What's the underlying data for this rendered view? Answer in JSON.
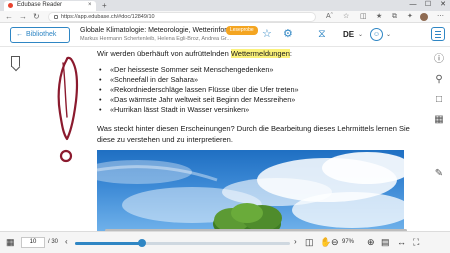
{
  "browser": {
    "tab_title": "Edubase Reader",
    "tab_close": "×",
    "new_tab": "+",
    "url": "https://app.edubase.ch/#doc/12849/10",
    "win_min": "—",
    "win_max": "☐",
    "win_close": "✕"
  },
  "header": {
    "back_label": "Bibliothek",
    "title": "Globale Klimatologie: Meteorologie, Wetterinform...",
    "authors": "Markus Hermann Schertenleib, Helena Egli-Broz, Andrea Gr...",
    "badge": "Leseprobe",
    "language": "DE"
  },
  "content": {
    "intro_prefix": "Wir werden überhäuft von aufrüttelnden ",
    "intro_highlight": "Wettermeldungen",
    "intro_suffix": ":",
    "bullets": [
      "«Der heisseste Sommer seit Menschengedenken»",
      "«Schneefall in der Sahara»",
      "«Rekordniederschläge lassen Flüsse über die Ufer treten»",
      "«Das wärmste Jahr weltweit seit Beginn der Messreihen»",
      "«Hurrikan lässt Stadt in Wasser versinken»"
    ],
    "paragraph": "Was steckt hinter diesen Erscheinungen? Durch die Bearbeitung dieses Lehrmittels lernen Sie diese zu verstehen und zu interpretieren."
  },
  "pagebar": {
    "current_page": "10",
    "total_pages": "/ 30",
    "progress": 0.31,
    "zoom": "97%"
  },
  "colors": {
    "accent": "#2f86c4",
    "badge": "#f4a521",
    "highlight": "#fbf27a",
    "annotation": "#8b1a2e"
  },
  "icons": {
    "left_rail": "bookmark-icon",
    "right_tools": [
      "help-icon",
      "search-icon",
      "notes-icon",
      "layers-icon",
      "pen-icon"
    ]
  }
}
